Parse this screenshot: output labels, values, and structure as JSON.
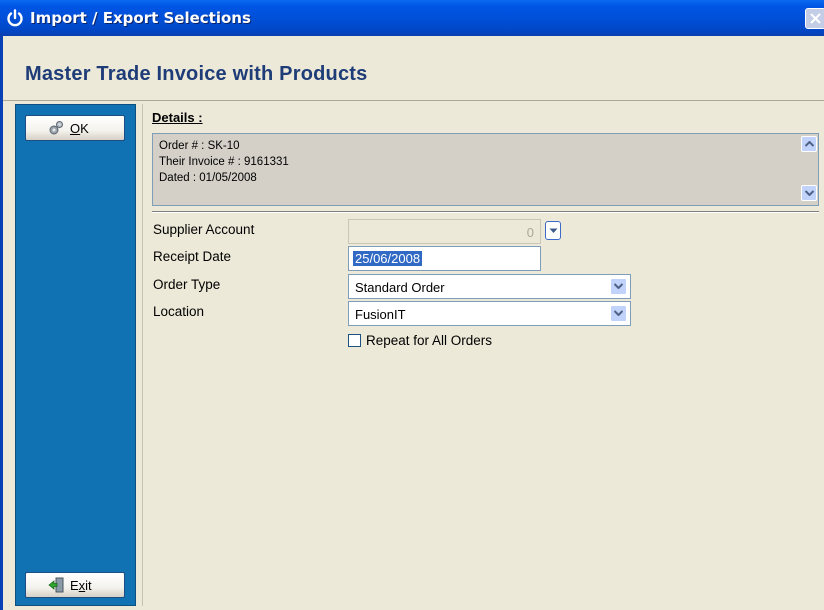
{
  "window": {
    "title": "Import / Export Selections"
  },
  "page": {
    "title": "Master Trade Invoice with Products"
  },
  "sidebar": {
    "ok": {
      "label": "OK",
      "mnemonic": "O",
      "rest": "K"
    },
    "exit": {
      "label": "Exit",
      "mnemonic": "x",
      "pre": "E",
      "rest": "it"
    }
  },
  "details": {
    "label": "Details :",
    "lines": [
      "Order # : SK-10",
      "Their Invoice # : 9161331",
      "Dated : 01/05/2008"
    ]
  },
  "form": {
    "supplier_account": {
      "label": "Supplier Account",
      "value": "0"
    },
    "receipt_date": {
      "label": "Receipt Date",
      "value": "25/06/2008"
    },
    "order_type": {
      "label": "Order Type",
      "value": "Standard Order"
    },
    "location": {
      "label": "Location",
      "value": "FusionIT"
    },
    "repeat": {
      "label": "Repeat for All Orders",
      "checked": false
    }
  },
  "colors": {
    "titlebar": "#0050d8",
    "sidebar": "#1072b2",
    "title_text": "#1e3c78",
    "selection": "#316ac5"
  }
}
